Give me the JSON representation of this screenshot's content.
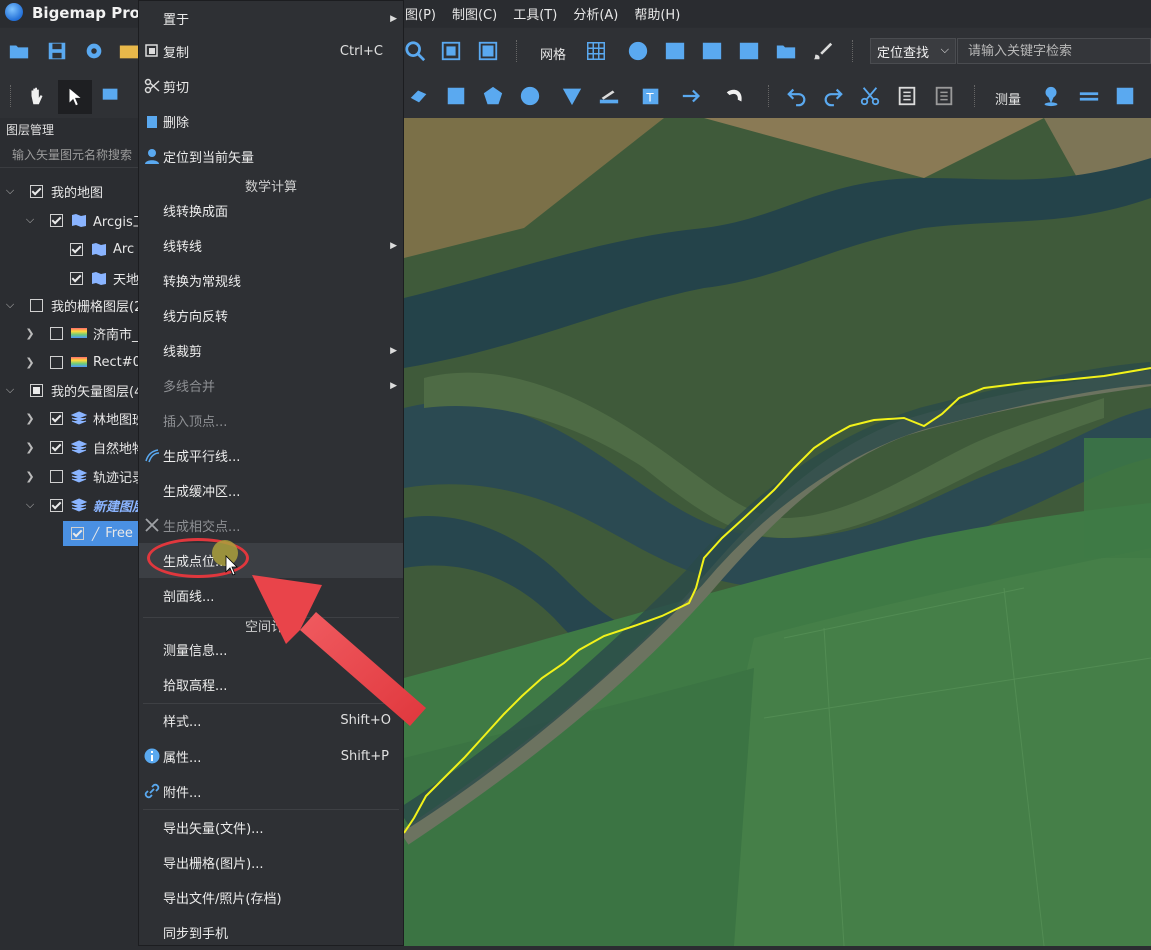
{
  "app": {
    "title": "Bigemap Pro"
  },
  "menubar": [
    "图(P)",
    "制图(C)",
    "工具(T)",
    "分析(A)",
    "帮助(H)"
  ],
  "toolbar": {
    "grid_label": "网格",
    "locate_label": "定位查找",
    "search_placeholder": "请输入关键字检索",
    "measure_label": "测量"
  },
  "layer_panel": {
    "header": "图层管理",
    "search_placeholder": "输入矢量图元名称搜索",
    "rows": [
      {
        "label": "我的地图"
      },
      {
        "label": "Arcgis卫"
      },
      {
        "label": "Arc"
      },
      {
        "label": "天地"
      },
      {
        "label": "我的栅格图层(2"
      },
      {
        "label": "济南市_"
      },
      {
        "label": "Rect#0"
      },
      {
        "label": "我的矢量图层(4"
      },
      {
        "label": "林地图班"
      },
      {
        "label": "自然地物"
      },
      {
        "label": "轨迹记录"
      },
      {
        "label": "新建图层"
      },
      {
        "label": "Free"
      }
    ]
  },
  "context_menu": {
    "items": [
      {
        "label": "置于",
        "shortcut": "",
        "submenu": true
      },
      {
        "label": "复制",
        "shortcut": "Ctrl+C"
      },
      {
        "label": "剪切",
        "shortcut": ""
      },
      {
        "label": "删除",
        "shortcut": ""
      },
      {
        "label": "定位到当前矢量",
        "shortcut": ""
      },
      {
        "label": "线转换成面",
        "shortcut": ""
      },
      {
        "label": "线转线",
        "shortcut": "",
        "submenu": true
      },
      {
        "label": "转换为常规线",
        "shortcut": ""
      },
      {
        "label": "线方向反转",
        "shortcut": ""
      },
      {
        "label": "线裁剪",
        "shortcut": "",
        "submenu": true
      },
      {
        "label": "多线合并",
        "shortcut": "",
        "submenu": true
      },
      {
        "label": "插入顶点...",
        "shortcut": ""
      },
      {
        "label": "生成平行线...",
        "shortcut": ""
      },
      {
        "label": "生成缓冲区...",
        "shortcut": ""
      },
      {
        "label": "生成相交点...",
        "shortcut": ""
      },
      {
        "label": "生成点位...",
        "shortcut": ""
      },
      {
        "label": "剖面线...",
        "shortcut": ""
      },
      {
        "label": "测量信息...",
        "shortcut": ""
      },
      {
        "label": "拾取高程...",
        "shortcut": ""
      },
      {
        "label": "样式...",
        "shortcut": "Shift+O"
      },
      {
        "label": "属性...",
        "shortcut": "Shift+P"
      },
      {
        "label": "附件...",
        "shortcut": ""
      },
      {
        "label": "导出矢量(文件)...",
        "shortcut": ""
      },
      {
        "label": "导出栅格(图片)...",
        "shortcut": ""
      },
      {
        "label": "导出文件/照片(存档)",
        "shortcut": ""
      },
      {
        "label": "同步到手机",
        "shortcut": ""
      }
    ],
    "sections": {
      "math": "数学计算",
      "spatial": "空间计算"
    }
  },
  "colors": {
    "accent": "#4a90e2",
    "highlight": "#e0373d",
    "line": "#f2f21a"
  }
}
